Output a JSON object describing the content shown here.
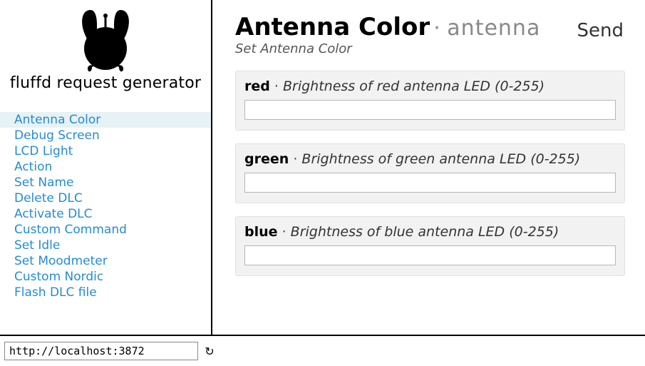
{
  "app": {
    "title": "fluffd request generator"
  },
  "sidebar": {
    "items": [
      {
        "label": "Antenna Color",
        "selected": true
      },
      {
        "label": "Debug Screen",
        "selected": false
      },
      {
        "label": "LCD Light",
        "selected": false
      },
      {
        "label": "Action",
        "selected": false
      },
      {
        "label": "Set Name",
        "selected": false
      },
      {
        "label": "Delete DLC",
        "selected": false
      },
      {
        "label": "Activate DLC",
        "selected": false
      },
      {
        "label": "Custom Command",
        "selected": false
      },
      {
        "label": "Set Idle",
        "selected": false
      },
      {
        "label": "Set Moodmeter",
        "selected": false
      },
      {
        "label": "Custom Nordic",
        "selected": false
      },
      {
        "label": "Flash DLC file",
        "selected": false
      }
    ]
  },
  "footer": {
    "url_value": "http://localhost:3872",
    "reload_glyph": "↻"
  },
  "page": {
    "title": "Antenna Color",
    "subtitle": "antenna",
    "description": "Set Antenna Color",
    "send_label": "Send",
    "sep": " · "
  },
  "params": [
    {
      "name": "red",
      "desc": "Brightness of red antenna LED (0-255)",
      "value": ""
    },
    {
      "name": "green",
      "desc": "Brightness of green antenna LED (0-255)",
      "value": ""
    },
    {
      "name": "blue",
      "desc": "Brightness of blue antenna LED (0-255)",
      "value": ""
    }
  ]
}
